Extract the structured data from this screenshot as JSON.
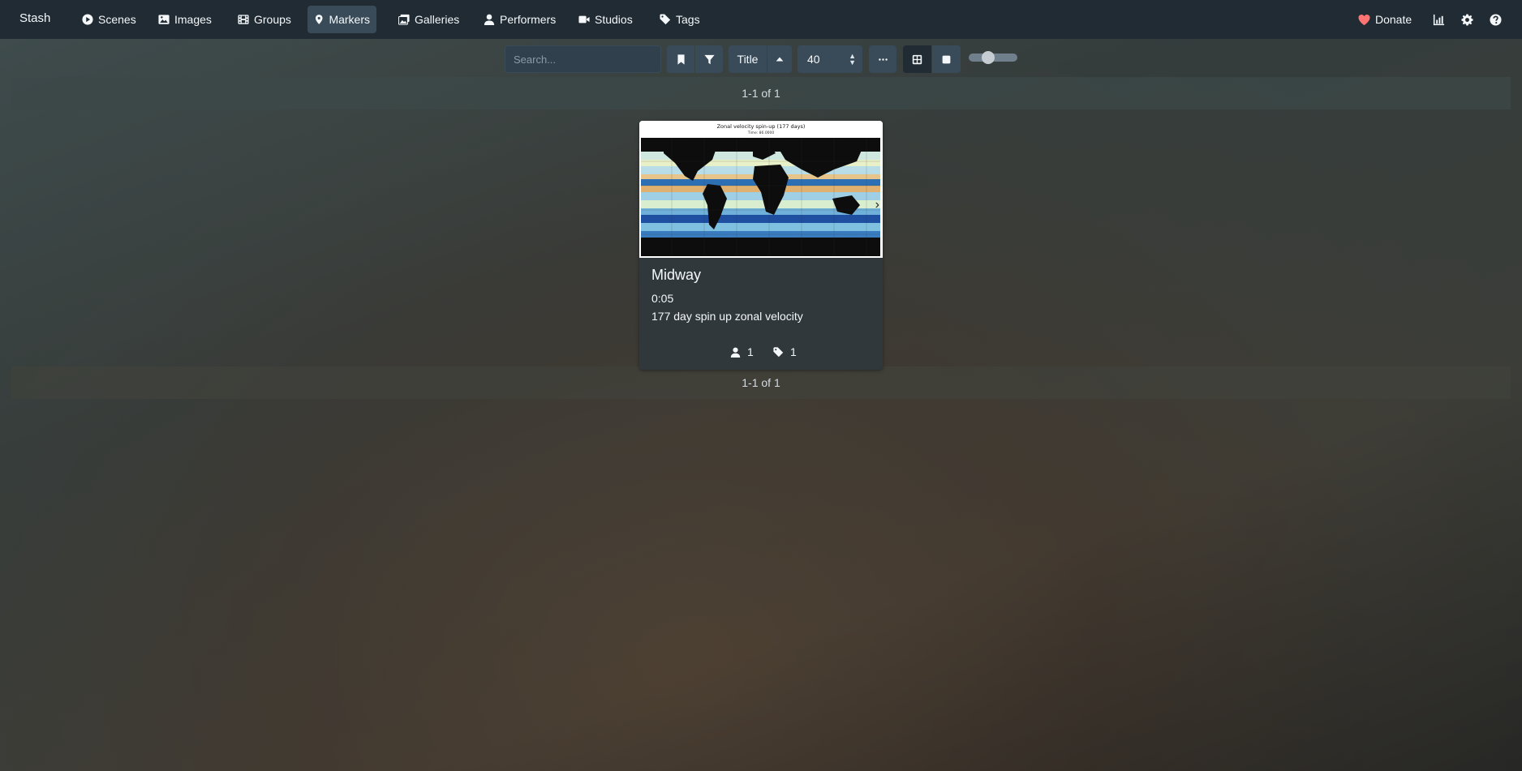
{
  "navbar": {
    "brand": "Stash",
    "items": [
      {
        "label": "Scenes",
        "icon": "play-circle-icon"
      },
      {
        "label": "Images",
        "icon": "image-icon"
      },
      {
        "label": "Groups",
        "icon": "film-icon"
      },
      {
        "label": "Markers",
        "icon": "map-marker-icon",
        "active": true
      },
      {
        "label": "Galleries",
        "icon": "images-icon"
      },
      {
        "label": "Performers",
        "icon": "user-icon"
      },
      {
        "label": "Studios",
        "icon": "video-icon"
      },
      {
        "label": "Tags",
        "icon": "tag-icon"
      }
    ],
    "donate_label": "Donate",
    "right_icons": [
      "stats-chart-icon",
      "gear-icon",
      "help-icon"
    ]
  },
  "toolbar": {
    "search_placeholder": "Search...",
    "sort_by": "Title",
    "per_page": "40"
  },
  "pagination": {
    "top": "1-1 of 1",
    "bottom": "1-1 of 1"
  },
  "card": {
    "title": "Midway",
    "time": "0:05",
    "description": "177 day spin up zonal velocity",
    "thumbnail_title": "Zonal velocity spin-up (177 days)",
    "thumbnail_subtitle": "Time: 86.0000",
    "performer_count": "1",
    "tag_count": "1"
  },
  "colors": {
    "navbar_bg": "#202b33",
    "active_nav": "#394b59",
    "button_bg": "#394b59",
    "donate_heart": "#ff7373"
  }
}
